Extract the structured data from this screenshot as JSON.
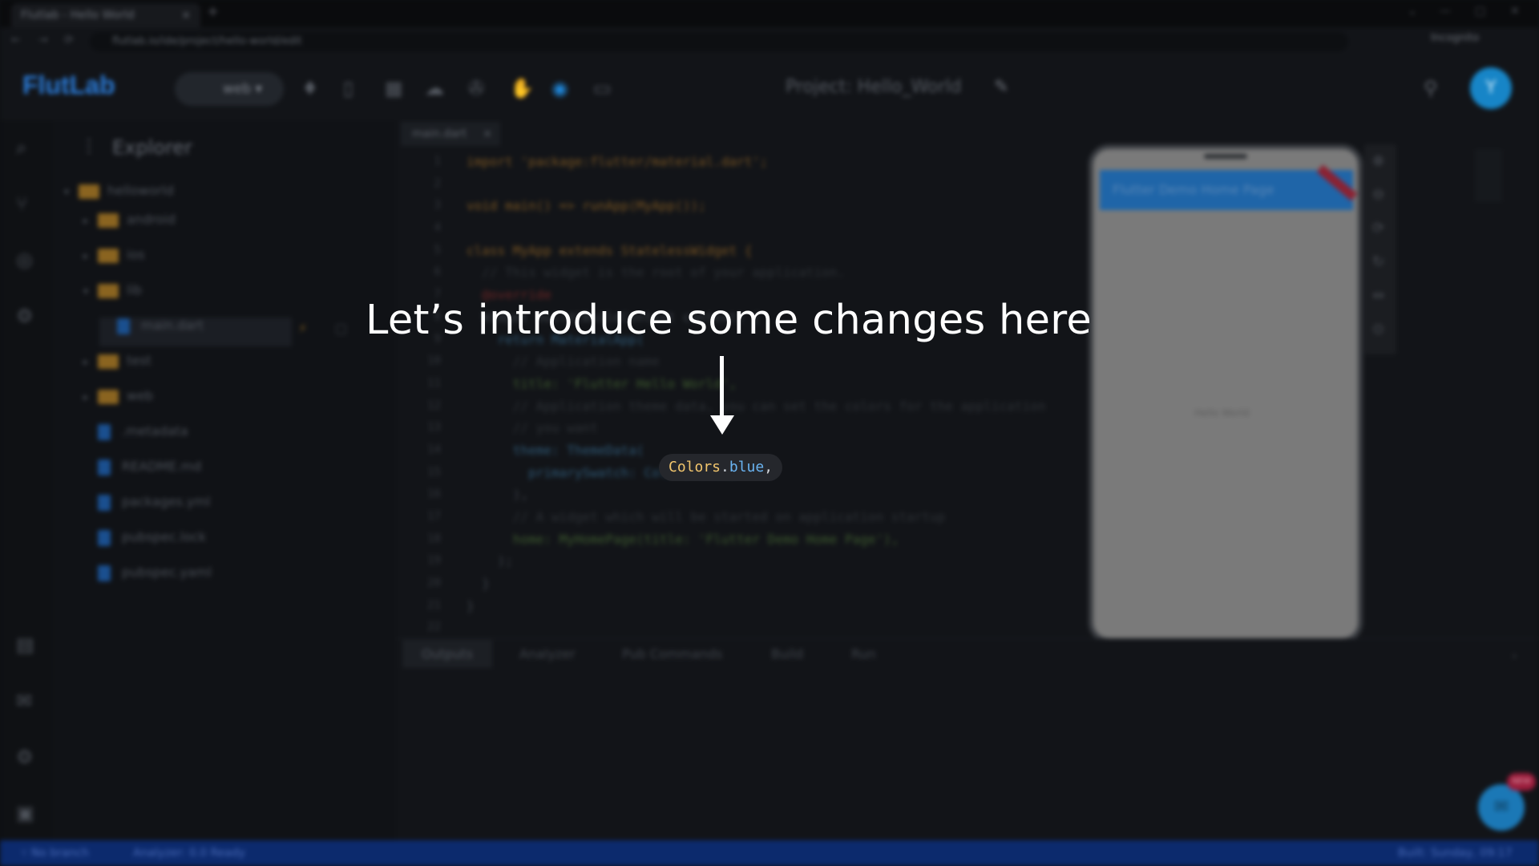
{
  "browser": {
    "tab_title": "Flutlab - Hello World",
    "tab_close": "×",
    "new_tab": "+",
    "window_controls": [
      "⌄",
      "—",
      "□",
      "✕"
    ],
    "nav": [
      "←",
      "→",
      "⟳"
    ],
    "url": "flutlab.io/ide/project/hello-world/edit",
    "profile_label": "Incognito"
  },
  "toolbar": {
    "logo_text": "FlutLab",
    "platform": "web ▾",
    "icons": [
      "♦",
      "▯",
      "▦",
      "☁",
      "✇",
      "✋",
      "◉",
      "▭"
    ],
    "project_label": "Project: Hello_World",
    "avatar_initial": "Y"
  },
  "activity_bar": [
    "⌕",
    "⑂",
    "◎",
    "⚙",
    "▤",
    "✉",
    "⚙",
    "▣"
  ],
  "explorer": {
    "title": "Explorer",
    "kebab": "⋮",
    "root": "helloworld",
    "items": [
      {
        "kind": "folder",
        "label": "android",
        "depth": 1,
        "caret": "▸"
      },
      {
        "kind": "folder",
        "label": "ios",
        "depth": 1,
        "caret": "▸"
      },
      {
        "kind": "folder",
        "label": "lib",
        "depth": 1,
        "caret": "▾"
      },
      {
        "kind": "file",
        "label": "main.dart",
        "depth": 2,
        "caret": ""
      },
      {
        "kind": "folder",
        "label": "test",
        "depth": 1,
        "caret": "▸"
      },
      {
        "kind": "folder",
        "label": "web",
        "depth": 1,
        "caret": "▸"
      },
      {
        "kind": "file",
        "label": ".metadata",
        "depth": 1,
        "caret": ""
      },
      {
        "kind": "file",
        "label": "README.md",
        "depth": 1,
        "caret": ""
      },
      {
        "kind": "file",
        "label": "packages.yml",
        "depth": 1,
        "caret": ""
      },
      {
        "kind": "file",
        "label": "pubspec.lock",
        "depth": 1,
        "caret": ""
      },
      {
        "kind": "file",
        "label": "pubspec.yaml",
        "depth": 1,
        "caret": ""
      }
    ]
  },
  "editor": {
    "tab_label": "main.dart",
    "tab_close": "×",
    "line_numbers": [
      "1",
      "2",
      "3",
      "4",
      "5",
      "6",
      "7",
      "8",
      "9",
      "10",
      "11",
      "12",
      "13",
      "14",
      "15",
      "16",
      "17",
      "18",
      "19",
      "20",
      "21",
      "22"
    ],
    "code_lines": [
      "import 'package:flutter/material.dart';",
      "",
      "void main() => runApp(MyApp());",
      "",
      "class MyApp extends StatelessWidget {",
      "  // This widget is the root of your application.",
      "  @override",
      "  Widget build(BuildContext context) {",
      "    return MaterialApp(",
      "      // Application name",
      "      title: 'Flutter Hello World',",
      "      // Application theme data, you can set the colors for the application",
      "      // you want",
      "      theme: ThemeData(",
      "        primarySwatch: Colors.blue,",
      "      ),",
      "      // A widget which will be started on application startup",
      "      home: MyHomePage(title: 'Flutter Demo Home Page'),",
      "    );",
      "  }",
      "}",
      ""
    ]
  },
  "preview": {
    "appbar_title": "Flutter Demo Home Page",
    "body_text": "Hello World",
    "tools": [
      "⊕",
      "⊖",
      "⟳",
      "↻",
      "⇔",
      "⊙"
    ]
  },
  "panel": {
    "tabs": [
      "Outputs",
      "Analyzer",
      "Pub Commands",
      "Build",
      "Run"
    ]
  },
  "fab": {
    "badge": "NEW",
    "icon": "✉"
  },
  "statusbar": {
    "left": [
      "⑂ No branch",
      "Analyzer: 0.0 Ready"
    ],
    "right": "Built: Sunday, 09:17"
  },
  "overlay": {
    "caption": "Let’s introduce some changes here",
    "snippet": {
      "class_name": "Colors",
      "dot": ".",
      "member": "blue",
      "comma": ","
    }
  },
  "colors": {
    "background": "#0e1013",
    "accent": "#1f86d9",
    "snippet_class": "#f2c66d",
    "snippet_member": "#6ab4f2",
    "statusbar": "#0c2a6d"
  }
}
